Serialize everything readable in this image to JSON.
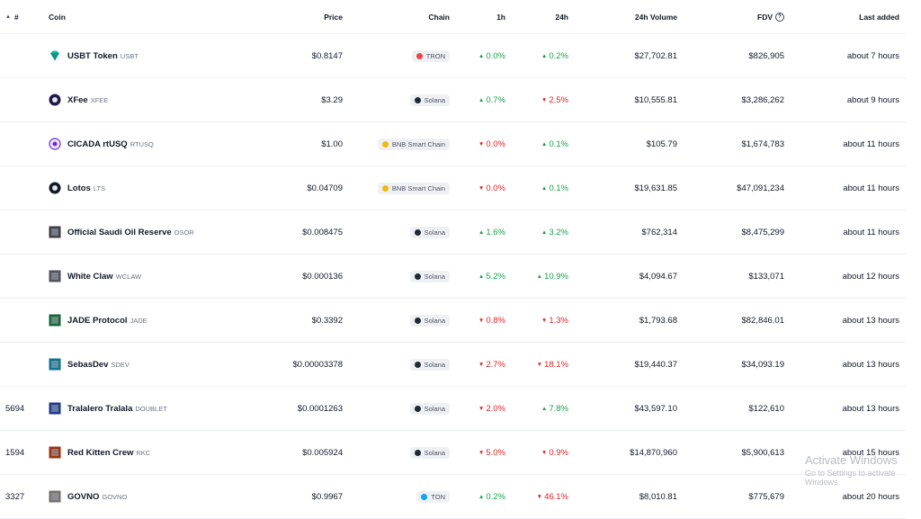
{
  "header": {
    "rank": "#",
    "coin": "Coin",
    "price": "Price",
    "chain": "Chain",
    "h1": "1h",
    "h24": "24h",
    "volume": "24h Volume",
    "fdv": "FDV",
    "last_added": "Last added"
  },
  "rows": [
    {
      "rank": "",
      "name": "USBT Token",
      "symbol": "USBT",
      "icon": "diamond-icon",
      "icon_color": "#14b8a6",
      "price": "$0.8147",
      "chain": "TRON",
      "chain_color": "#ef4444",
      "h1": "0.0%",
      "h1_dir": "up",
      "h24": "0.2%",
      "h24_dir": "up",
      "volume": "$27,702.81",
      "fdv": "$826,905",
      "added": "about 7 hours"
    },
    {
      "rank": "",
      "name": "XFee",
      "symbol": "XFEE",
      "icon": "xfee-logo-icon",
      "icon_color": "#1e1b4b",
      "price": "$3.29",
      "chain": "Solana",
      "chain_color": "#1f2937",
      "h1": "0.7%",
      "h1_dir": "up",
      "h24": "2.5%",
      "h24_dir": "down",
      "volume": "$10,555.81",
      "fdv": "$3,286,262",
      "added": "about 9 hours"
    },
    {
      "rank": "",
      "name": "CICADA rtUSQ",
      "symbol": "RTUSQ",
      "icon": "cicada-logo-icon",
      "icon_color": "#6d28d9",
      "price": "$1.00",
      "chain": "BNB Smart Chain",
      "chain_color": "#f0b90b",
      "h1": "0.0%",
      "h1_dir": "down",
      "h24": "0.1%",
      "h24_dir": "up",
      "volume": "$105.79",
      "fdv": "$1,674,783",
      "added": "about 11 hours"
    },
    {
      "rank": "",
      "name": "Lotos",
      "symbol": "LTS",
      "icon": "lotos-logo-icon",
      "icon_color": "#111827",
      "price": "$0.04709",
      "chain": "BNB Smart Chain",
      "chain_color": "#f0b90b",
      "h1": "0.0%",
      "h1_dir": "down",
      "h24": "0.1%",
      "h24_dir": "up",
      "volume": "$19,631.85",
      "fdv": "$47,091,234",
      "added": "about 11 hours"
    },
    {
      "rank": "",
      "name": "Official Saudi Oil Reserve",
      "symbol": "OSOR",
      "icon": "osor-logo-icon",
      "icon_color": "#3f3f46",
      "price": "$0.008475",
      "chain": "Solana",
      "chain_color": "#1f2937",
      "h1": "1.6%",
      "h1_dir": "up",
      "h24": "3.2%",
      "h24_dir": "up",
      "volume": "$762,314",
      "fdv": "$8,475,299",
      "added": "about 11 hours"
    },
    {
      "rank": "",
      "name": "White Claw",
      "symbol": "WCLAW",
      "icon": "wclaw-logo-icon",
      "icon_color": "#52525b",
      "price": "$0.000136",
      "chain": "Solana",
      "chain_color": "#1f2937",
      "h1": "5.2%",
      "h1_dir": "up",
      "h24": "10.9%",
      "h24_dir": "up",
      "volume": "$4,094.67",
      "fdv": "$133,071",
      "added": "about 12 hours"
    },
    {
      "rank": "",
      "name": "JADE Protocol",
      "symbol": "JADE",
      "icon": "jade-logo-icon",
      "icon_color": "#166534",
      "price": "$0.3392",
      "chain": "Solana",
      "chain_color": "#1f2937",
      "h1": "0.8%",
      "h1_dir": "down",
      "h24": "1.3%",
      "h24_dir": "down",
      "volume": "$1,793.68",
      "fdv": "$82,846.01",
      "added": "about 13 hours"
    },
    {
      "rank": "",
      "name": "SebasDev",
      "symbol": "SDEV",
      "icon": "sdev-logo-icon",
      "icon_color": "#0e7490",
      "price": "$0.00003378",
      "chain": "Solana",
      "chain_color": "#1f2937",
      "h1": "2.7%",
      "h1_dir": "down",
      "h24": "18.1%",
      "h24_dir": "down",
      "volume": "$19,440.37",
      "fdv": "$34,093.19",
      "added": "about 13 hours"
    },
    {
      "rank": "5694",
      "name": "Tralalero Tralala",
      "symbol": "DOUBLET",
      "icon": "doublet-logo-icon",
      "icon_color": "#1e3a8a",
      "price": "$0.0001263",
      "chain": "Solana",
      "chain_color": "#1f2937",
      "h1": "2.0%",
      "h1_dir": "down",
      "h24": "7.8%",
      "h24_dir": "up",
      "volume": "$43,597.10",
      "fdv": "$122,610",
      "added": "about 13 hours"
    },
    {
      "rank": "1594",
      "name": "Red Kitten Crew",
      "symbol": "RKC",
      "icon": "rkc-logo-icon",
      "icon_color": "#9a3412",
      "price": "$0.005924",
      "chain": "Solana",
      "chain_color": "#1f2937",
      "h1": "5.0%",
      "h1_dir": "down",
      "h24": "0.9%",
      "h24_dir": "down",
      "volume": "$14,870,960",
      "fdv": "$5,900,613",
      "added": "about 15 hours"
    },
    {
      "rank": "3327",
      "name": "GOVNO",
      "symbol": "GOVNO",
      "icon": "govno-logo-icon",
      "icon_color": "#78716c",
      "price": "$0.9967",
      "chain": "TON",
      "chain_color": "#0ea5e9",
      "h1": "0.2%",
      "h1_dir": "up",
      "h24": "46.1%",
      "h24_dir": "down",
      "volume": "$8,010.81",
      "fdv": "$775,679",
      "added": "about 20 hours"
    }
  ],
  "watermark": {
    "title": "Activate Windows",
    "subtitle": "Go to Settings to activate Windows."
  }
}
